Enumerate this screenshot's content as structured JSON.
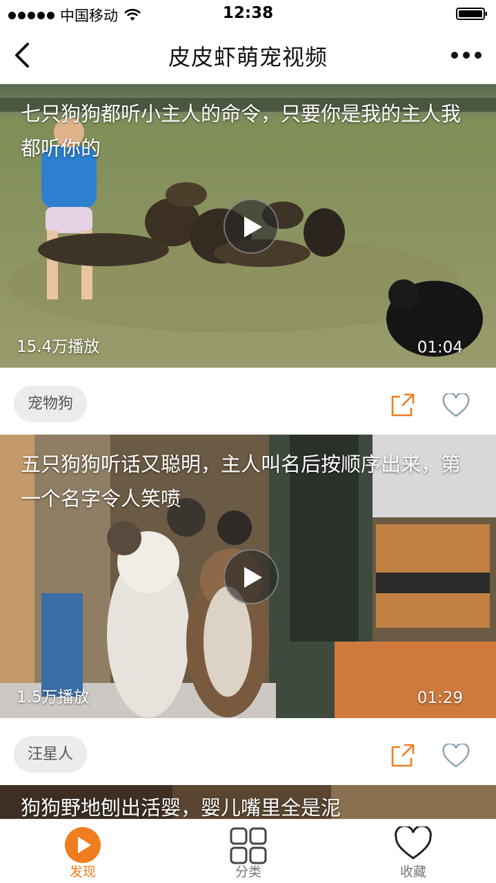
{
  "status_bar": {
    "carrier": "中国移动",
    "time": "12:38"
  },
  "nav": {
    "title": "皮皮虾萌宠视频"
  },
  "videos": [
    {
      "title": "七只狗狗都听小主人的命令，只要你是我的主人我都听你的",
      "plays": "15.4万播放",
      "duration": "01:04",
      "tag": "宠物狗"
    },
    {
      "title": "五只狗狗听话又聪明，主人叫名后按顺序出来，第一个名字令人笑喷",
      "plays": "1.5万播放",
      "duration": "01:29",
      "tag": "汪星人"
    },
    {
      "title": "狗狗野地刨出活婴，婴儿嘴里全是泥"
    }
  ],
  "tabs": [
    {
      "label": "发现",
      "icon": "play-circle-icon",
      "active": true
    },
    {
      "label": "分类",
      "icon": "grid-icon",
      "active": false
    },
    {
      "label": "收藏",
      "icon": "heart-icon",
      "active": false
    }
  ],
  "colors": {
    "accent": "#f07d1e",
    "icon_gray": "#8aa0ad"
  }
}
